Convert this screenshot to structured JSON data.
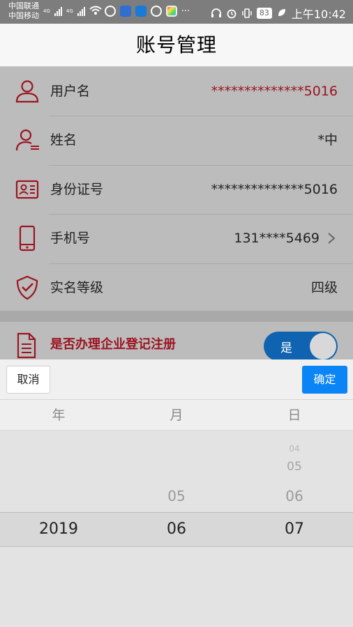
{
  "status_bar": {
    "carrier_1": "中国联通",
    "carrier_2": "中国移动",
    "net_1": "4G",
    "net_2": "4G",
    "battery": "83",
    "time": "上午10:42"
  },
  "header": {
    "title": "账号管理"
  },
  "rows": [
    {
      "label": "用户名",
      "value": "**************5016",
      "icon": "user-icon"
    },
    {
      "label": "姓名",
      "value": "*中",
      "icon": "user-card-icon"
    },
    {
      "label": "身份证号",
      "value": "**************5016",
      "icon": "id-card-icon"
    },
    {
      "label": "手机号",
      "value": "131****5469",
      "icon": "mobile-phone-icon"
    },
    {
      "label": "实名等级",
      "value": "四级",
      "icon": "shield-check-icon"
    }
  ],
  "registration": {
    "label": "是否办理企业登记注册",
    "toggle_label": "是",
    "icon": "document-icon"
  },
  "picker": {
    "cancel_label": "取消",
    "confirm_label": "确定",
    "columns": [
      "年",
      "月",
      "日"
    ],
    "year": {
      "options": [
        "2019"
      ],
      "selected": "2019"
    },
    "month": {
      "options": [
        "05",
        "06"
      ],
      "selected": "06"
    },
    "day": {
      "options": [
        "04",
        "05",
        "06",
        "07"
      ],
      "selected": "07"
    }
  },
  "colors": {
    "accent_red": "#9b1420",
    "toggle_blue": "#0f63b0",
    "confirm_blue": "#0b84f5"
  }
}
